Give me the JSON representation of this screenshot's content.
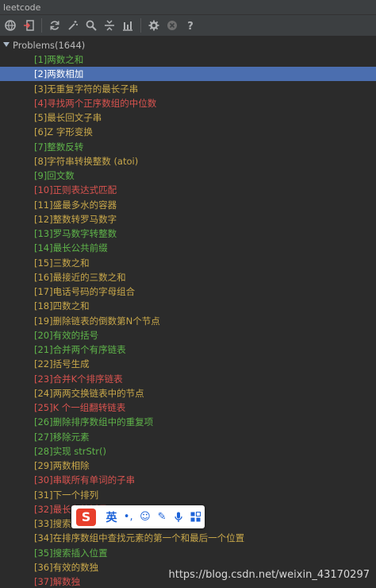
{
  "window": {
    "title": "leetcode"
  },
  "colors": {
    "easy": "#5fb44a",
    "medium": "#c9a84a",
    "hard": "#d9534f",
    "selected_bg": "#4b6eaf",
    "background": "#2b2b2b"
  },
  "toolbar": {
    "buttons": [
      {
        "name": "globe-icon"
      },
      {
        "name": "login-icon"
      },
      {
        "name": "refresh-icon"
      },
      {
        "name": "magic-wand-icon"
      },
      {
        "name": "search-icon"
      },
      {
        "name": "collapse-icon"
      },
      {
        "name": "chart-icon"
      },
      {
        "name": "gear-icon"
      },
      {
        "name": "close-circle-icon"
      },
      {
        "name": "help-icon"
      }
    ]
  },
  "tree": {
    "root_label": "Problems(1644)",
    "selected_index": 1,
    "items": [
      {
        "label": "[1]两数之和",
        "level": "easy"
      },
      {
        "label": "[2]两数相加",
        "level": "medium"
      },
      {
        "label": "[3]无重复字符的最长子串",
        "level": "medium"
      },
      {
        "label": "[4]寻找两个正序数组的中位数",
        "level": "hard"
      },
      {
        "label": "[5]最长回文子串",
        "level": "medium"
      },
      {
        "label": "[6]Z 字形变换",
        "level": "medium"
      },
      {
        "label": "[7]整数反转",
        "level": "easy"
      },
      {
        "label": "[8]字符串转换整数 (atoi)",
        "level": "medium"
      },
      {
        "label": "[9]回文数",
        "level": "easy"
      },
      {
        "label": "[10]正则表达式匹配",
        "level": "hard"
      },
      {
        "label": "[11]盛最多水的容器",
        "level": "medium"
      },
      {
        "label": "[12]整数转罗马数字",
        "level": "medium"
      },
      {
        "label": "[13]罗马数字转整数",
        "level": "easy"
      },
      {
        "label": "[14]最长公共前缀",
        "level": "easy"
      },
      {
        "label": "[15]三数之和",
        "level": "medium"
      },
      {
        "label": "[16]最接近的三数之和",
        "level": "medium"
      },
      {
        "label": "[17]电话号码的字母组合",
        "level": "medium"
      },
      {
        "label": "[18]四数之和",
        "level": "medium"
      },
      {
        "label": "[19]删除链表的倒数第N个节点",
        "level": "medium"
      },
      {
        "label": "[20]有效的括号",
        "level": "easy"
      },
      {
        "label": "[21]合并两个有序链表",
        "level": "easy"
      },
      {
        "label": "[22]括号生成",
        "level": "medium"
      },
      {
        "label": "[23]合并K个排序链表",
        "level": "hard"
      },
      {
        "label": "[24]两两交换链表中的节点",
        "level": "medium"
      },
      {
        "label": "[25]K 个一组翻转链表",
        "level": "hard"
      },
      {
        "label": "[26]删除排序数组中的重复项",
        "level": "easy"
      },
      {
        "label": "[27]移除元素",
        "level": "easy"
      },
      {
        "label": "[28]实现 strStr()",
        "level": "easy"
      },
      {
        "label": "[29]两数相除",
        "level": "medium"
      },
      {
        "label": "[30]串联所有单词的子串",
        "level": "hard"
      },
      {
        "label": "[31]下一个排列",
        "level": "medium"
      },
      {
        "label": "[32]最长有效括号",
        "level": "hard"
      },
      {
        "label": "[33]搜索旋转排序数组",
        "level": "medium"
      },
      {
        "label": "[34]在排序数组中查找元素的第一个和最后一个位置",
        "level": "medium"
      },
      {
        "label": "[35]搜索插入位置",
        "level": "easy"
      },
      {
        "label": "[36]有效的数独",
        "level": "medium"
      },
      {
        "label": "[37]解数独",
        "level": "hard"
      }
    ]
  },
  "ime_toolbar": {
    "logo": "S",
    "lang": "英",
    "items": [
      {
        "name": "punctuation-icon",
        "glyph": "•,"
      },
      {
        "name": "emoji-icon",
        "glyph": "☺"
      },
      {
        "name": "pen-icon",
        "glyph": "✎"
      },
      {
        "name": "microphone-icon",
        "glyph": "🎤"
      },
      {
        "name": "grid-icon",
        "glyph": "▦"
      }
    ]
  },
  "watermark": "https://blog.csdn.net/weixin_43170297"
}
